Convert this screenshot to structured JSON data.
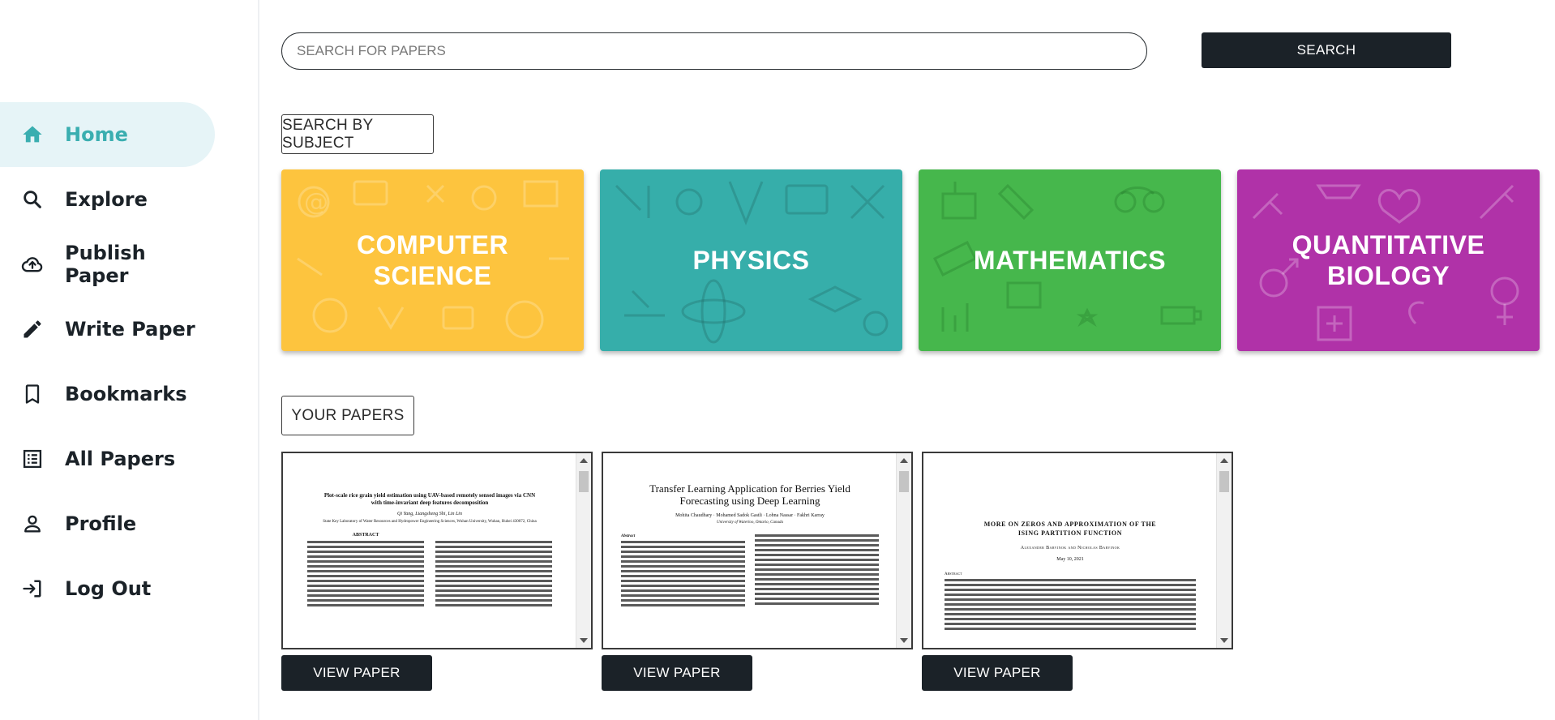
{
  "sidebar": {
    "items": [
      {
        "label": "Home",
        "icon": "home-icon",
        "active": true
      },
      {
        "label": "Explore",
        "icon": "search-icon"
      },
      {
        "label": "Publish Paper",
        "icon": "cloud-upload-icon"
      },
      {
        "label": "Write Paper",
        "icon": "pencil-icon"
      },
      {
        "label": "Bookmarks",
        "icon": "bookmark-icon"
      },
      {
        "label": "All Papers",
        "icon": "list-icon"
      },
      {
        "label": "Profile",
        "icon": "person-icon"
      },
      {
        "label": "Log Out",
        "icon": "logout-icon"
      }
    ],
    "active_color": "#3aaeb0"
  },
  "search": {
    "placeholder": "SEARCH FOR PAPERS",
    "button_label": "SEARCH"
  },
  "subjects": {
    "section_label": "SEARCH BY SUBJECT",
    "cards": [
      {
        "label": "COMPUTER SCIENCE",
        "color": "#fdc43e"
      },
      {
        "label": "PHYSICS",
        "color": "#36aeaa"
      },
      {
        "label": "MATHEMATICS",
        "color": "#46b74c"
      },
      {
        "label": "QUANTITATIVE BIOLOGY",
        "color": "#b032a8"
      }
    ]
  },
  "your_papers": {
    "section_label": "YOUR PAPERS",
    "papers": [
      {
        "title": "Plot-scale rice grain yield estimation using UAV-based remotely sensed images via CNN with time-invariant deep features decomposition",
        "authors": "Qi Yang, Liangsheng Shi, Lin Lin",
        "affiliation": "State Key Laboratory of Water Resources and Hydropower Engineering Sciences, Wuhan University, Wuhan, Hubei 430072, China",
        "section": "ABSTRACT",
        "button_label": "VIEW PAPER"
      },
      {
        "title": "Transfer Learning Application for Berries Yield Forecasting using Deep Learning",
        "authors": "Mohita Chaudhary · Mohamed Sadok Gastli · Lobna Nassar · Fakhri Karray",
        "affiliation": "University of Waterloo, Ontario, Canada",
        "section": "Abstract",
        "button_label": "VIEW PAPER"
      },
      {
        "title": "MORE ON ZEROS AND APPROXIMATION OF THE ISING PARTITION FUNCTION",
        "authors": "Alexander Barvinok and Nicholas Barvinok",
        "affiliation": "May 10, 2021",
        "section": "Abstract",
        "button_label": "VIEW PAPER"
      }
    ]
  }
}
